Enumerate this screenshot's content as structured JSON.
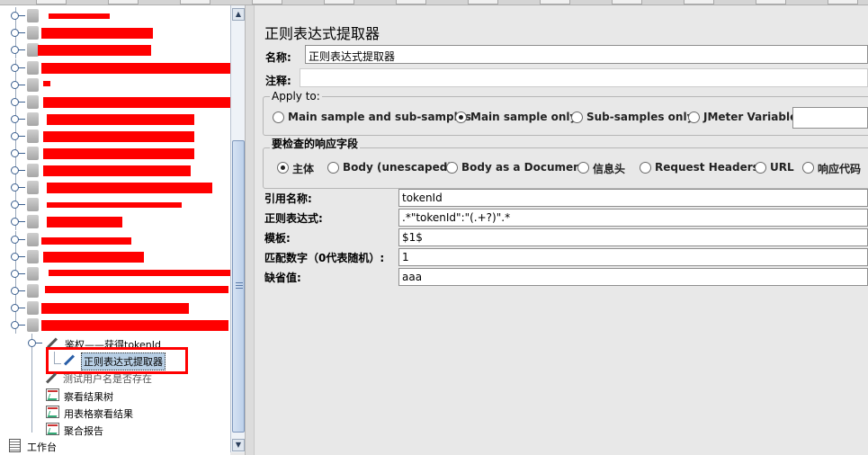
{
  "tree": {
    "selected_item": "正则表达式提取器",
    "items": [
      {
        "label": "鉴权——获得tokenId",
        "icon": "sampler-icon"
      },
      {
        "label": "测试用户名是否存在",
        "icon": "sampler-icon"
      },
      {
        "label": "察看结果树",
        "icon": "listener-icon"
      },
      {
        "label": "用表格察看结果",
        "icon": "listener-icon"
      },
      {
        "label": "聚合报告",
        "icon": "listener-icon"
      }
    ],
    "workbench_label": "工作台"
  },
  "panel": {
    "title": "正则表达式提取器",
    "name_label": "名称:",
    "name_value": "正则表达式提取器",
    "comment_label": "注释:",
    "apply_to": {
      "legend": "Apply to:",
      "options": [
        "Main sample and sub-samples",
        "Main sample only",
        "Sub-samples only",
        "JMeter Variable"
      ],
      "selected": "Main sample only"
    },
    "response_field": {
      "legend": "要检查的响应字段",
      "options": [
        "主体",
        "Body (unescaped)",
        "Body as a Document",
        "信息头",
        "Request Headers",
        "URL",
        "响应代码"
      ],
      "selected": "主体"
    },
    "fields": {
      "ref_name_label": "引用名称:",
      "ref_name_value": "tokenId",
      "regex_label": "正则表达式:",
      "regex_value": ".*\"tokenId\":\"(.+?)\".*",
      "template_label": "模板:",
      "template_value": "$1$",
      "match_no_label": "匹配数字（0代表随机）:",
      "match_no_value": "1",
      "default_label": "缺省值:",
      "default_value": "aaa"
    }
  }
}
